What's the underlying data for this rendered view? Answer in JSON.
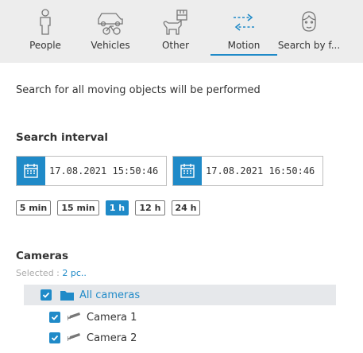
{
  "tabs": [
    {
      "label": "People",
      "icon": "person-icon"
    },
    {
      "label": "Vehicles",
      "icon": "vehicle-icon"
    },
    {
      "label": "Other",
      "icon": "other-objects-icon"
    },
    {
      "label": "Motion",
      "icon": "motion-arrows-icon",
      "active": true
    },
    {
      "label": "Search by f...",
      "icon": "face-icon"
    }
  ],
  "description": "Search for all moving objects will be performed",
  "search_interval": {
    "title": "Search interval",
    "from": "17.08.2021  15:50:46",
    "to": "17.08.2021  16:50:46",
    "quick_ranges": [
      "5 min",
      "15 min",
      "1 h",
      "12 h",
      "24 h"
    ],
    "active_range": "1 h"
  },
  "cameras": {
    "title": "Cameras",
    "selected_label": "Selected :",
    "selected_count": "2 pc..",
    "all_label": "All cameras",
    "items": [
      {
        "label": "Camera 1",
        "checked": true
      },
      {
        "label": "Camera 2",
        "checked": true
      }
    ]
  },
  "colors": {
    "accent": "#1f8ac8",
    "tabbar": "#ededed",
    "highlight": "#e6e8eb"
  }
}
